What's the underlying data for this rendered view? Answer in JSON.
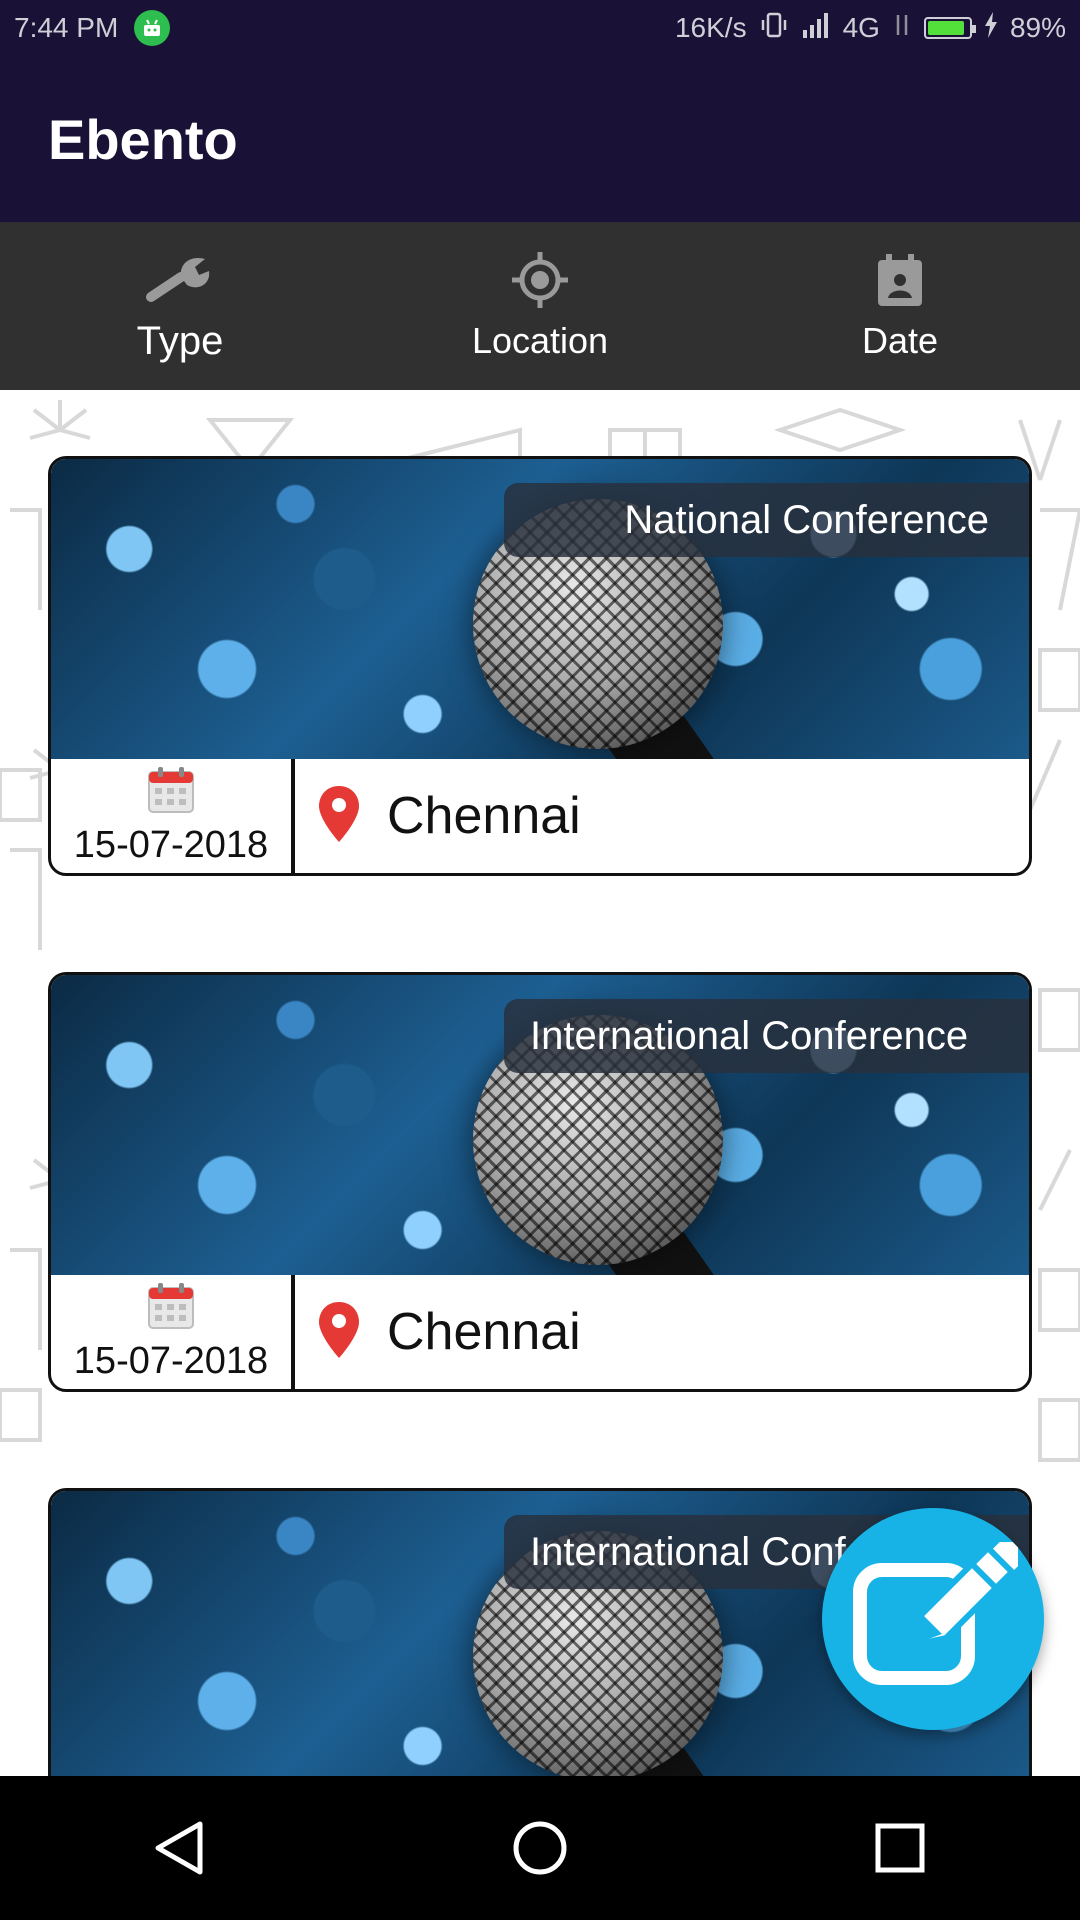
{
  "status_bar": {
    "time": "7:44 PM",
    "net_speed": "16K/s",
    "network": "4G",
    "battery": "89%"
  },
  "app_bar": {
    "title": "Ebento"
  },
  "filters": [
    {
      "label": "Type",
      "icon": "wrench-icon",
      "active": true
    },
    {
      "label": "Location",
      "icon": "crosshair-icon",
      "active": false
    },
    {
      "label": "Date",
      "icon": "calendar-person-icon",
      "active": false
    }
  ],
  "events": [
    {
      "type": "National Conference",
      "date": "15-07-2018",
      "location": "Chennai"
    },
    {
      "type": "International Conference",
      "date": "15-07-2018",
      "location": "Chennai"
    },
    {
      "type": "International Conference",
      "date": "",
      "location": ""
    }
  ],
  "colors": {
    "primary_dark": "#1a1236",
    "filter_bar": "#303030",
    "fab": "#17b3e6",
    "pin": "#e53935"
  }
}
